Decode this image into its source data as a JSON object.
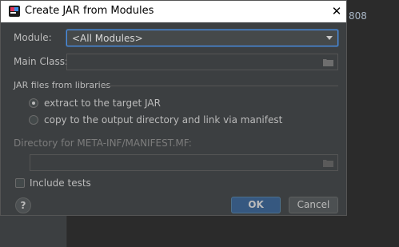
{
  "background": {
    "ide_text": "808"
  },
  "dialog": {
    "title": "Create JAR from Modules",
    "close_glyph": "✕",
    "module_label": "Module:",
    "module_value": "<All Modules>",
    "main_class_label": "Main Class:",
    "main_class_value": "",
    "libraries_section": "JAR files from libraries",
    "radio_extract": "extract to the target JAR",
    "radio_copy": "copy to the output directory and link via manifest",
    "selected_option": "extract",
    "manifest_dir_label": "Directory for META-INF/MANIFEST.MF:",
    "manifest_dir_value": "",
    "include_tests_label": "Include tests",
    "include_tests_checked": false,
    "help_glyph": "?",
    "ok_label": "OK",
    "cancel_label": "Cancel"
  },
  "colors": {
    "accent": "#4c8be0",
    "ok_button": "#365880",
    "dialog_bg": "#3c3f41"
  }
}
